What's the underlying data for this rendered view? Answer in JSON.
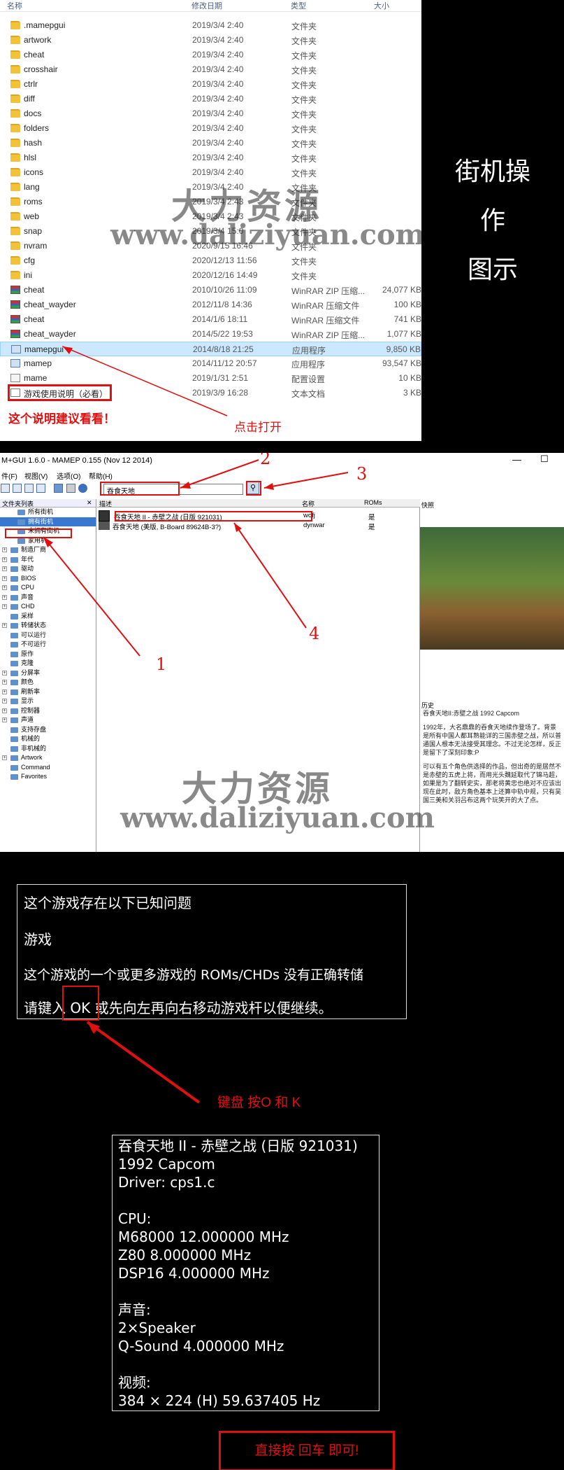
{
  "explorer": {
    "columns": {
      "name": "名称",
      "date": "修改日期",
      "type": "类型",
      "size": "大小"
    },
    "rows": [
      {
        "name": ".mamepgui",
        "date": "2019/3/4 2:40",
        "type": "文件夹",
        "size": "",
        "icon": "folder"
      },
      {
        "name": "artwork",
        "date": "2019/3/4 2:40",
        "type": "文件夹",
        "size": "",
        "icon": "folder"
      },
      {
        "name": "cheat",
        "date": "2019/3/4 2:40",
        "type": "文件夹",
        "size": "",
        "icon": "folder"
      },
      {
        "name": "crosshair",
        "date": "2019/3/4 2:40",
        "type": "文件夹",
        "size": "",
        "icon": "folder"
      },
      {
        "name": "ctrlr",
        "date": "2019/3/4 2:40",
        "type": "文件夹",
        "size": "",
        "icon": "folder"
      },
      {
        "name": "diff",
        "date": "2019/3/4 2:40",
        "type": "文件夹",
        "size": "",
        "icon": "folder"
      },
      {
        "name": "docs",
        "date": "2019/3/4 2:40",
        "type": "文件夹",
        "size": "",
        "icon": "folder"
      },
      {
        "name": "folders",
        "date": "2019/3/4 2:40",
        "type": "文件夹",
        "size": "",
        "icon": "folder"
      },
      {
        "name": "hash",
        "date": "2019/3/4 2:40",
        "type": "文件夹",
        "size": "",
        "icon": "folder"
      },
      {
        "name": "hlsl",
        "date": "2019/3/4 2:40",
        "type": "文件夹",
        "size": "",
        "icon": "folder"
      },
      {
        "name": "icons",
        "date": "2019/3/4 2:40",
        "type": "文件夹",
        "size": "",
        "icon": "folder"
      },
      {
        "name": "lang",
        "date": "2019/3/4 2:40",
        "type": "文件夹",
        "size": "",
        "icon": "folder"
      },
      {
        "name": "roms",
        "date": "2019/3/4 2:43",
        "type": "文件夹",
        "size": "",
        "icon": "folder"
      },
      {
        "name": "web",
        "date": "2019/3/4 2:43",
        "type": "文件夹",
        "size": "",
        "icon": "folder"
      },
      {
        "name": "snap",
        "date": "2019/3/4 15:0",
        "type": "文件夹",
        "size": "",
        "icon": "folder"
      },
      {
        "name": "nvram",
        "date": "2020/9/15 16:46",
        "type": "文件夹",
        "size": "",
        "icon": "folder"
      },
      {
        "name": "cfg",
        "date": "2020/12/13 11:56",
        "type": "文件夹",
        "size": "",
        "icon": "folder"
      },
      {
        "name": "ini",
        "date": "2020/12/16 14:49",
        "type": "文件夹",
        "size": "",
        "icon": "folder"
      },
      {
        "name": "cheat",
        "date": "2010/10/26 11:09",
        "type": "WinRAR ZIP 压缩...",
        "size": "24,077 KB",
        "icon": "rar"
      },
      {
        "name": "cheat_wayder",
        "date": "2012/11/8 14:36",
        "type": "WinRAR 压缩文件",
        "size": "100 KB",
        "icon": "rar"
      },
      {
        "name": "cheat",
        "date": "2014/1/6 18:11",
        "type": "WinRAR 压缩文件",
        "size": "741 KB",
        "icon": "rar"
      },
      {
        "name": "cheat_wayder",
        "date": "2014/5/22 19:53",
        "type": "WinRAR ZIP 压缩...",
        "size": "1,077 KB",
        "icon": "rar"
      },
      {
        "name": "mamepgui",
        "date": "2014/8/18 21:25",
        "type": "应用程序",
        "size": "9,850 KB",
        "icon": "exe"
      },
      {
        "name": "mamep",
        "date": "2014/11/12 20:57",
        "type": "应用程序",
        "size": "93,547 KB",
        "icon": "exe"
      },
      {
        "name": "mame",
        "date": "2019/1/31 2:51",
        "type": "配置设置",
        "size": "10 KB",
        "icon": "cfg"
      },
      {
        "name": "游戏使用说明（必看）",
        "date": "2019/3/9 16:28",
        "type": "文本文档",
        "size": "3 KB",
        "icon": "txt"
      }
    ],
    "note_readme": "这个说明建议看看！",
    "note_open": "点击打开"
  },
  "side_title": {
    "line1": "街机操作",
    "line2": "图示"
  },
  "watermark": {
    "cn": "大力资源",
    "url": "www.daliziyuan.com"
  },
  "mame": {
    "title": "M+GUI 1.6.0 - MAMEP 0.155 (Nov 12 2014)",
    "menu": [
      "件(F)",
      "视图(V)",
      "选项(O)",
      "帮助(H)"
    ],
    "search_value": "吞食天地",
    "folder_header": "文件夹列表",
    "folders": [
      {
        "label": "所有街机",
        "exp": ""
      },
      {
        "label": "拥有街机",
        "exp": ""
      },
      {
        "label": "未拥有街机",
        "exp": ""
      },
      {
        "label": "家用机",
        "exp": ""
      },
      {
        "label": "制造厂商",
        "exp": "+"
      },
      {
        "label": "年代",
        "exp": "+"
      },
      {
        "label": "驱动",
        "exp": "+"
      },
      {
        "label": "BIOS",
        "exp": "+"
      },
      {
        "label": "CPU",
        "exp": "+"
      },
      {
        "label": "声音",
        "exp": "+"
      },
      {
        "label": "CHD",
        "exp": "+"
      },
      {
        "label": "采样",
        "exp": ""
      },
      {
        "label": "转储状态",
        "exp": "+"
      },
      {
        "label": "可以运行",
        "exp": ""
      },
      {
        "label": "不可运行",
        "exp": ""
      },
      {
        "label": "原作",
        "exp": ""
      },
      {
        "label": "克隆",
        "exp": ""
      },
      {
        "label": "分屏率",
        "exp": "+"
      },
      {
        "label": "颜色",
        "exp": "+"
      },
      {
        "label": "刷新率",
        "exp": "+"
      },
      {
        "label": "显示",
        "exp": "+"
      },
      {
        "label": "控制器",
        "exp": "+"
      },
      {
        "label": "声道",
        "exp": "+"
      },
      {
        "label": "支持存盘",
        "exp": ""
      },
      {
        "label": "机械的",
        "exp": ""
      },
      {
        "label": "非机械的",
        "exp": ""
      },
      {
        "label": "Artwork",
        "exp": "+"
      },
      {
        "label": "Command",
        "exp": ""
      },
      {
        "label": "Favorites",
        "exp": ""
      }
    ],
    "list_columns": {
      "desc": "描述",
      "name": "名称",
      "roms": "ROMs"
    },
    "games": [
      {
        "desc": "吞食天地 II - 赤壁之战 (日版 921031)",
        "name": "wofj",
        "roms": "是"
      },
      {
        "desc": "吞食天地 (美版, B-Board 89624B-3?)",
        "name": "dynwar",
        "roms": "是"
      }
    ],
    "snap_label": "快照",
    "history_label": "历史",
    "history": [
      "吞食天地II:赤壁之战 1992 Capcom",
      "1992年，大名鼎鼎的吞食天地续作登场了。背景是所有中国人都耳熟能详的三国赤壁之战，所以普通国人根本无法接受其理念。不过无论怎样，反正是留下了深刻印象:P",
      "可以有五个角色供选择的作品，但出奇的是居然不是赤壁的五虎上将，而用光头魏延取代了锦马超，如果是为了翻转史实，那老将黄忠也绝对不应该出现在此时，敌方角色基本上还算中轨中规，只有吴国三美和关羽吕布这两个玩笑开的大了点。"
    ],
    "num1": "1",
    "num2": "2",
    "num3": "3",
    "num4": "4"
  },
  "message": {
    "lines": [
      "这个游戏存在以下已知问题",
      "游戏",
      "这个游戏的一个或更多游戏的 ROMs/CHDs 没有正确转储",
      "请键入 OK 或先向左再向右移动游戏杆以便继续。"
    ],
    "key_hint": "键盘 按O 和 K"
  },
  "info": {
    "lines": [
      "吞食天地 II - 赤壁之战 (日版 921031)",
      "1992 Capcom",
      "Driver: cps1.c",
      "",
      "CPU:",
      "M68000 12.000000 MHz",
      "Z80 8.000000 MHz",
      "DSP16 4.000000 MHz",
      "",
      "声音:",
      "2×Speaker",
      "Q-Sound 4.000000 MHz",
      "",
      "视频:",
      "384 × 224 (H) 59.637405 Hz"
    ],
    "enter_hint": "直接按 回车  即可!"
  }
}
